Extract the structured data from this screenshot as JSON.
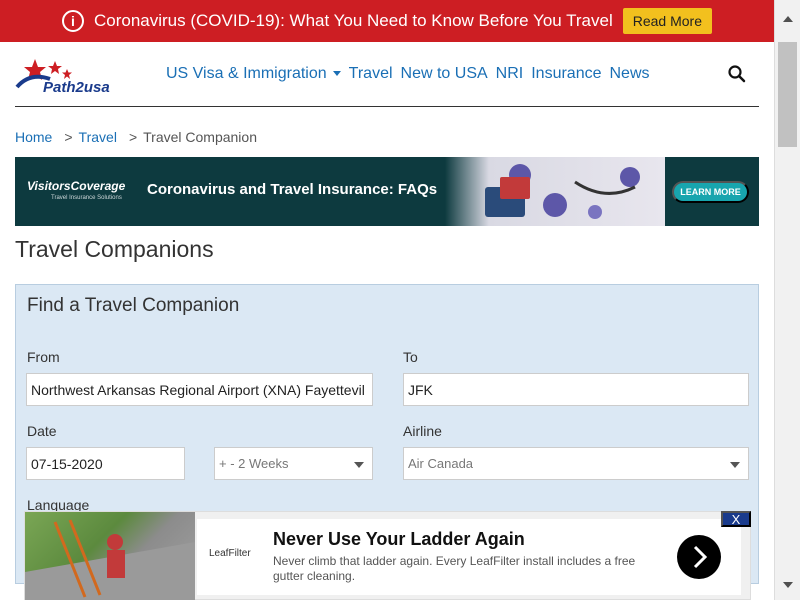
{
  "alert": {
    "text": "Coronavirus (COVID-19): What You Need to Know Before You Travel",
    "button": "Read More",
    "icon": "info-icon",
    "bg_color": "#cd1e23",
    "button_color": "#f2c01e"
  },
  "header": {
    "logo_text": "Path2usa",
    "nav": [
      {
        "label": "US Visa & Immigration",
        "has_dropdown": true
      },
      {
        "label": "Travel"
      },
      {
        "label": "New to USA"
      },
      {
        "label": "NRI"
      },
      {
        "label": "Insurance"
      },
      {
        "label": "News"
      }
    ],
    "search_icon": "search-icon",
    "link_color": "#1a6fb5"
  },
  "breadcrumb": {
    "home": "Home",
    "travel": "Travel",
    "current": "Travel Companion",
    "separator": ">"
  },
  "ad_banner": {
    "brand": "VisitorsCoverage",
    "brand_sub": "Travel Insurance Solutions",
    "title": "Coronavirus and Travel Insurance: FAQs",
    "button": "LEARN MORE"
  },
  "page": {
    "title": "Travel Companions"
  },
  "form": {
    "title": "Find a Travel Companion",
    "from_label": "From",
    "from_value": "Northwest Arkansas Regional Airport (XNA) Fayettevil",
    "to_label": "To",
    "to_value": "JFK",
    "date_label": "Date",
    "date_value": "07-15-2020",
    "range_value": "+ - 2 Weeks",
    "airline_label": "Airline",
    "airline_value": "Air Canada",
    "language_label": "Language"
  },
  "bottom_ad": {
    "logo": "LeafFilter",
    "title": "Never Use Your Ladder Again",
    "description": "Never climb that ladder again. Every LeafFilter install includes a free gutter cleaning.",
    "close": "X",
    "arrow_icon": "chevron-right-icon"
  }
}
